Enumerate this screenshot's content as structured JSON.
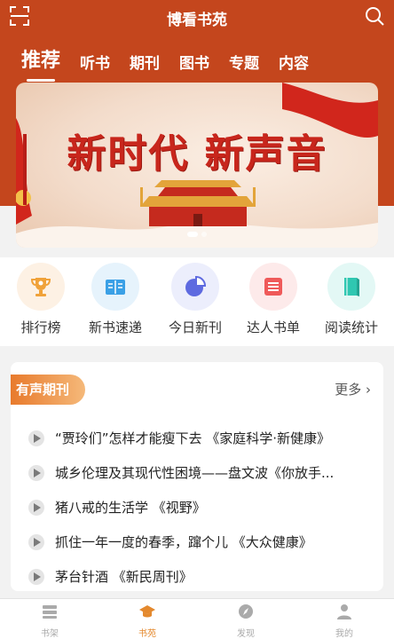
{
  "app": {
    "title": "博看书苑"
  },
  "header": {
    "scan_icon": "scan-icon",
    "search_icon": "search-icon",
    "tabs": [
      "推荐",
      "听书",
      "期刊",
      "图书",
      "专题",
      "内容"
    ],
    "active_tab_index": 0
  },
  "banner": {
    "headline": "新时代 新声音",
    "slide_count": 2,
    "active_slide": 1
  },
  "quick_links": [
    {
      "label": "排行榜",
      "icon": "trophy-icon",
      "color": "#f0a23a"
    },
    {
      "label": "新书速递",
      "icon": "book-open-icon",
      "color": "#3aa0e6"
    },
    {
      "label": "今日新刊",
      "icon": "pie-chart-icon",
      "color": "#5e6ae0"
    },
    {
      "label": "达人书单",
      "icon": "list-icon",
      "color": "#ef5a5a"
    },
    {
      "label": "阅读统计",
      "icon": "book-stack-icon",
      "color": "#2fc7b1"
    }
  ],
  "audio_journals": {
    "badge": "有声期刊",
    "more": "更多",
    "items": [
      "“贾玲们”怎样才能瘦下去 《家庭科学·新健康》",
      "城乡伦理及其现代性困境——盘文波《你放手...",
      "猪八戒的生活学 《视野》",
      "抓住一年一度的春季，蹿个儿 《大众健康》",
      "茅台针酒 《新民周刊》"
    ]
  },
  "bottom_nav": {
    "items": [
      {
        "label": "书架",
        "icon": "bookshelf-icon"
      },
      {
        "label": "书苑",
        "icon": "graduation-cap-icon"
      },
      {
        "label": "发现",
        "icon": "compass-icon"
      },
      {
        "label": "我的",
        "icon": "user-icon"
      }
    ],
    "active_index": 1
  },
  "colors": {
    "brand": "#c4461d",
    "accent": "#e4892e",
    "banner_text": "#c8261c"
  }
}
